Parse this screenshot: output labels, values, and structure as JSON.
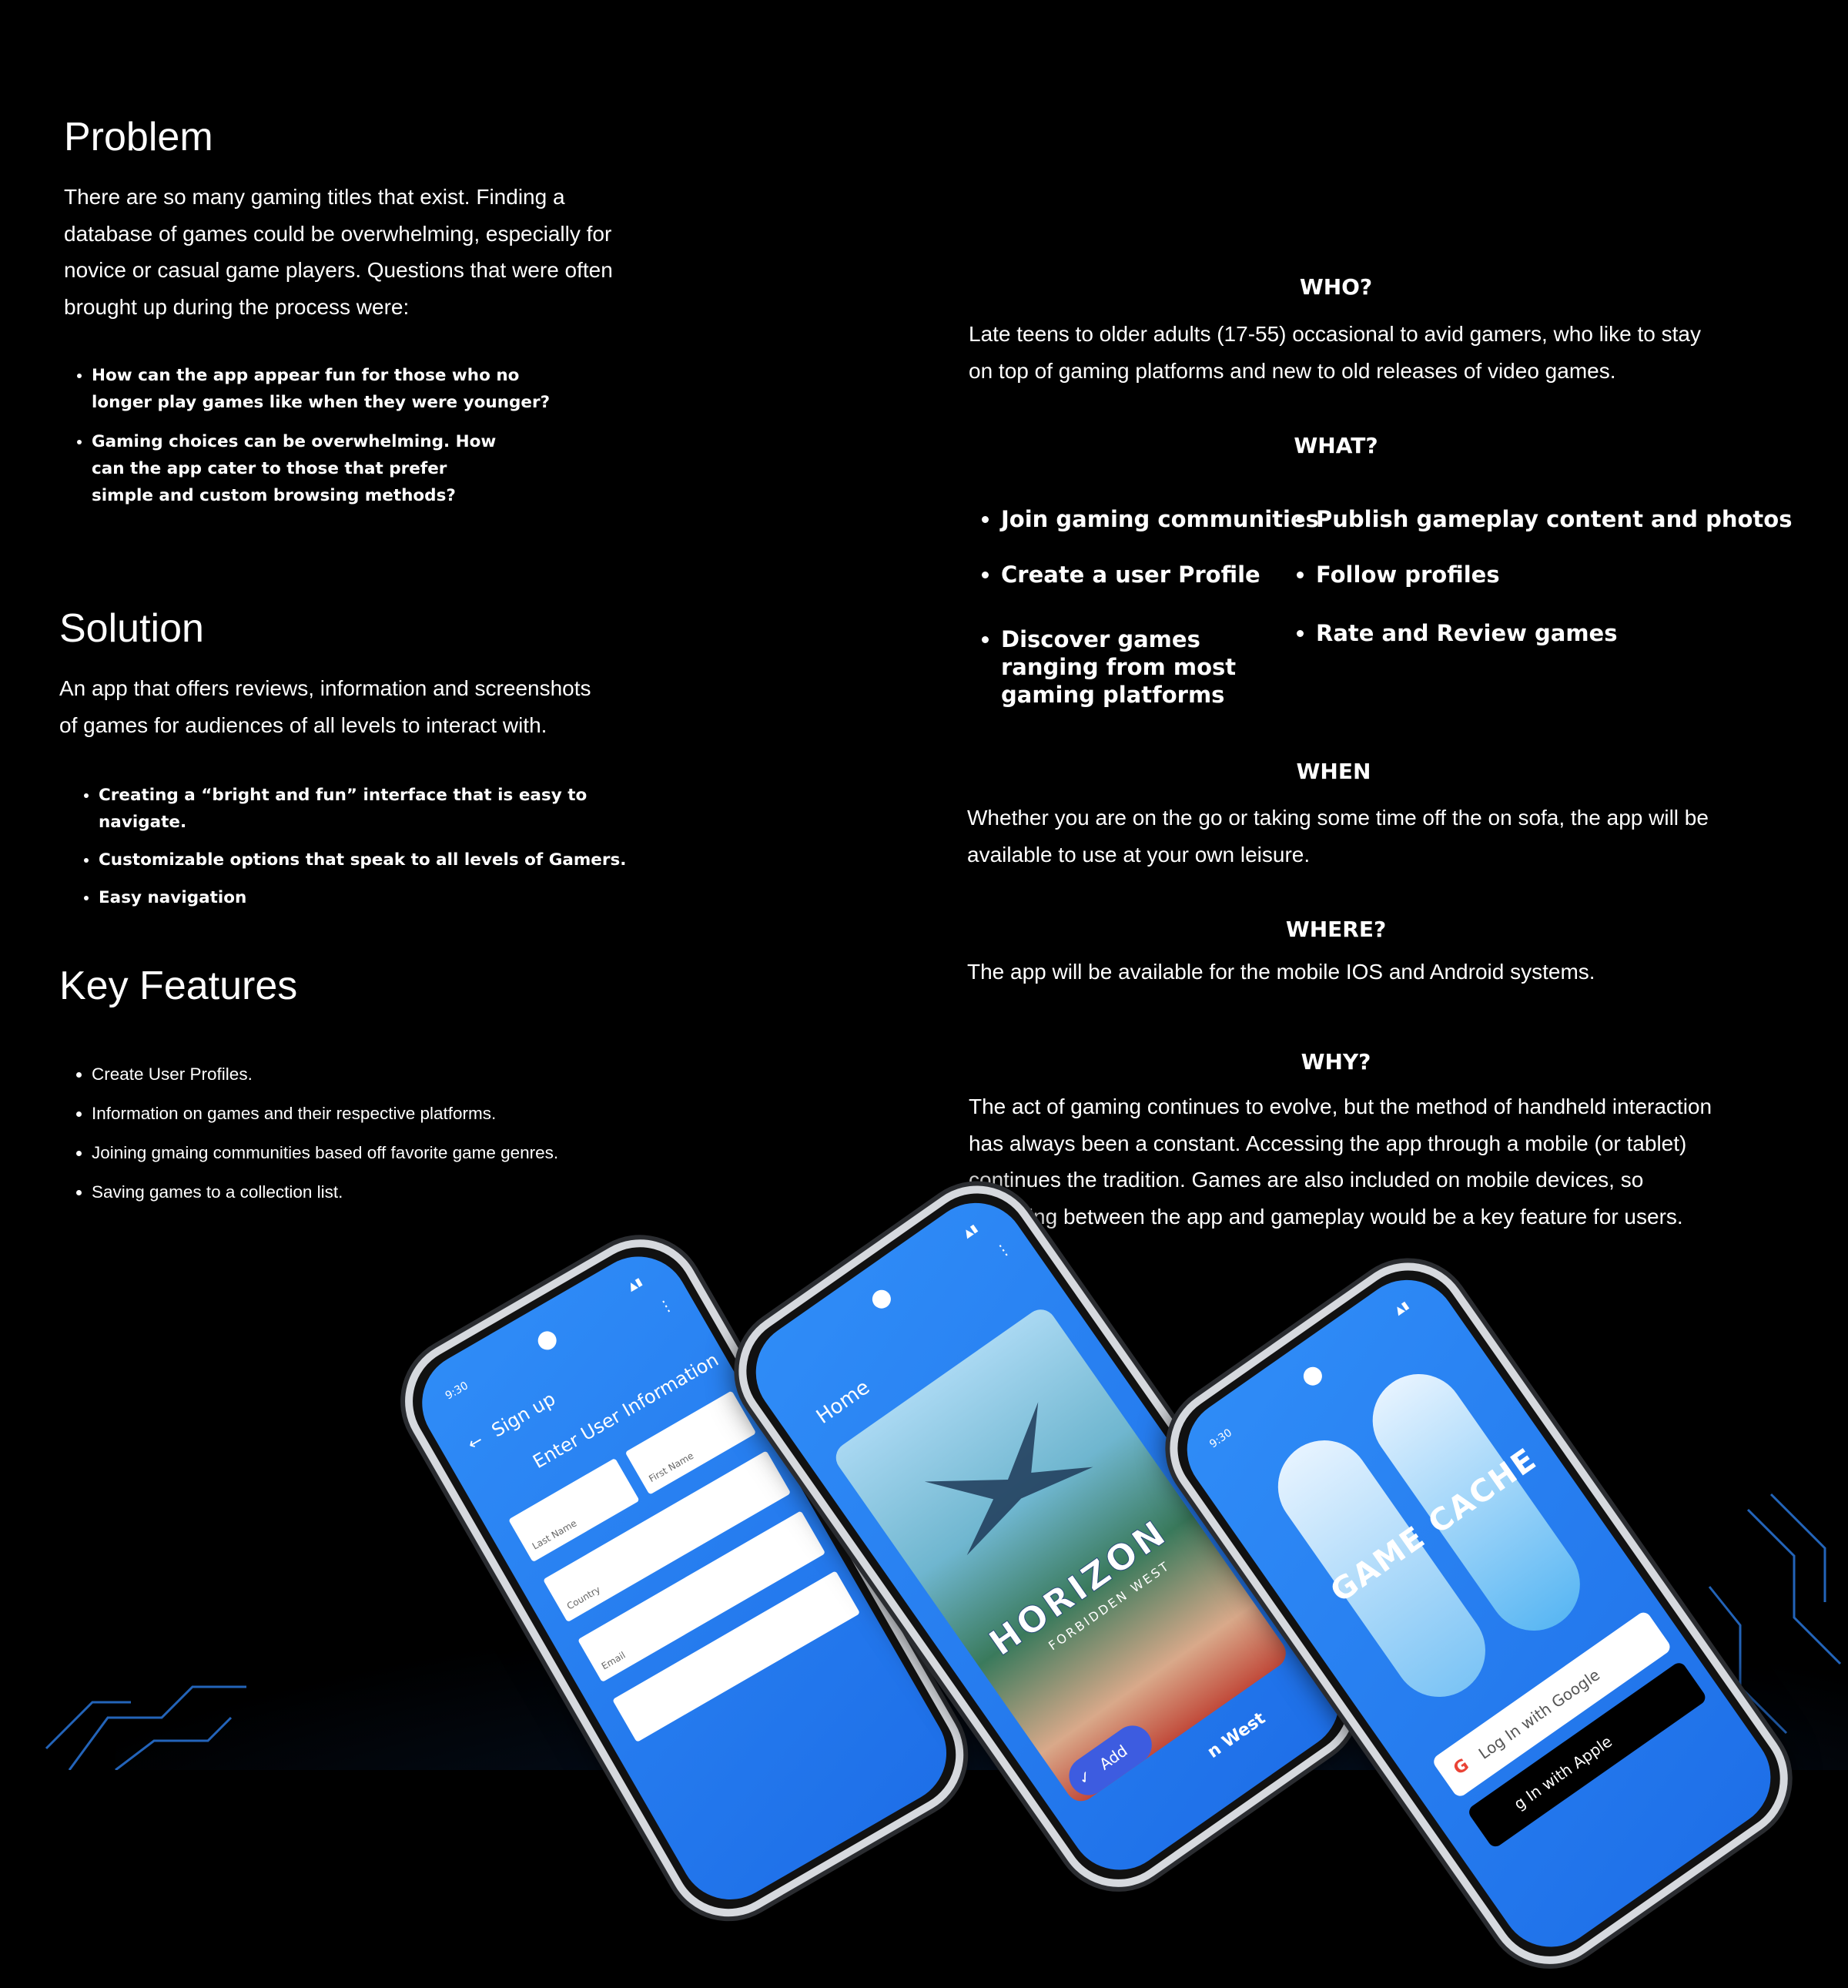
{
  "problem": {
    "heading": "Problem",
    "body": "There are so many gaming titles that exist. Finding a database of games could be overwhelming, especially for novice or casual game players. Questions that were often brought up during the process were:",
    "bullets": [
      "How can the app appear fun for those who no longer play games like when they were younger?",
      "Gaming choices can be overwhelming. How can the app cater to those that prefer simple and custom browsing methods?"
    ]
  },
  "solution": {
    "heading": "Solution",
    "body": "An app that offers reviews, information and screenshots of games for audiences of all levels to interact with.",
    "bullets": [
      "Creating a “bright and fun” interface that is easy to navigate.",
      "Customizable options that speak to all levels of Gamers.",
      "Easy navigation"
    ]
  },
  "features": {
    "heading": "Key Features",
    "bullets": [
      "Create User Profiles.",
      "Information on games and their respective platforms.",
      "Joining gmaing communities based off favorite game genres.",
      "Saving games to a collection list."
    ]
  },
  "who": {
    "heading": "WHO?",
    "body": "Late teens to older adults (17-55) occasional to avid gamers, who like to stay on top of gaming platforms and new to old releases of video games."
  },
  "what": {
    "heading": "WHAT?",
    "left": [
      "Join gaming communities",
      "Create a user Profile",
      "Discover games ranging from most gaming platforms"
    ],
    "right": [
      "Publish gameplay content and photos",
      "Follow profiles",
      "Rate and Review games"
    ]
  },
  "when": {
    "heading": "WHEN",
    "body": "Whether you are on the  go or taking some time off the on sofa, the app will be available to use at your own leisure."
  },
  "where": {
    "heading": "WHERE?",
    "body": "The app will be available for the mobile IOS and Android systems."
  },
  "why": {
    "heading": "WHY?",
    "body": "The act of gaming continues to evolve, but the method of handheld interaction has always been a constant. Accessing the app through a mobile (or tablet) continues the tradition. Games are also included on mobile devices, so switching between the app and gameplay would be a key feature for users."
  },
  "phones": {
    "signup": {
      "time": "9:30",
      "title": "Sign up",
      "subtitle": "Enter User Information",
      "first_name": "First Name",
      "last_name": "Last Name",
      "country": "Country",
      "email": "Email"
    },
    "home": {
      "title": "Home",
      "game_title": "HORIZON",
      "game_subtitle": "FORBIDDEN WEST",
      "add_label": "Add",
      "caption": "n West"
    },
    "login": {
      "time": "9:30",
      "logo_text": "GAME CACHE",
      "google_label": "Log In with Google",
      "apple_label": "g In with Apple"
    }
  },
  "colors": {
    "background": "#000000",
    "text": "#ffffff",
    "phone_blue": "#1e6fe8"
  }
}
